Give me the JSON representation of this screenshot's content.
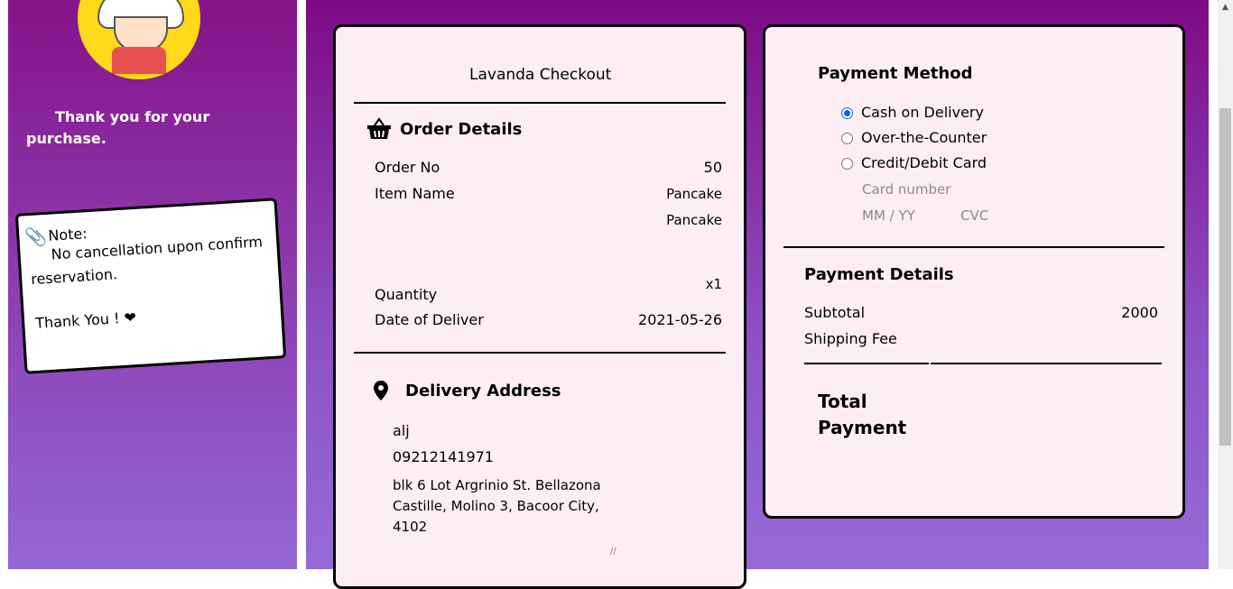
{
  "sidebar": {
    "thanks_text": "Thank you for your purchase.",
    "note_title": "Note:",
    "note_message": "No cancellation upon confirm reservation.",
    "note_thanks": "Thank You ! ❤"
  },
  "checkout": {
    "title": "Lavanda Checkout",
    "order_section_title": "Order Details",
    "order_no_label": "Order No",
    "order_no_value": "50",
    "item_name_label": "Item Name",
    "items": [
      "Pancake",
      "Pancake"
    ],
    "quantity_label": "Quantity",
    "quantity_value": "x1",
    "date_label": "Date of Deliver",
    "date_value": "2021-05-26",
    "address_section_title": "Delivery Address",
    "name": "alj",
    "phone": "09212141971",
    "address": "blk 6 Lot Argrinio St. Bellazona\nCastille, Molino 3, Bacoor City,\n4102"
  },
  "payment": {
    "method_title": "Payment Method",
    "options": [
      "Cash on Delivery",
      "Over-the-Counter",
      "Credit/Debit Card"
    ],
    "selected_option": "Cash on Delivery",
    "card_number_placeholder": "Card number",
    "expiry_placeholder": "MM / YY",
    "cvc_placeholder": "CVC",
    "details_title": "Payment Details",
    "subtotal_label": "Subtotal",
    "subtotal_value": "2000",
    "shipping_label": "Shipping Fee",
    "total_label_line1": "Total",
    "total_label_line2": "Payment"
  },
  "colors": {
    "sidebar_gradient_top": "#86138a",
    "sidebar_gradient_bottom": "#9467d6",
    "card_bg": "#fdeef4",
    "radio_accent": "#0a66d8"
  }
}
